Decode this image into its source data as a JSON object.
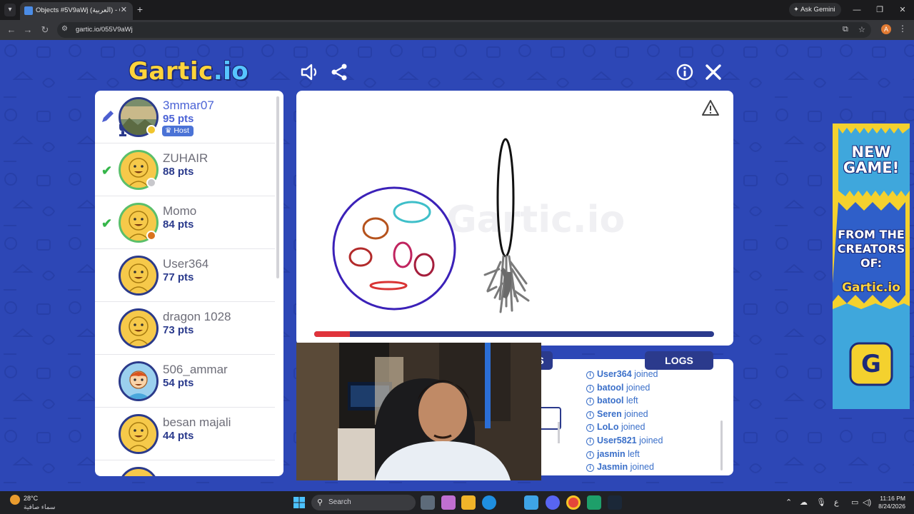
{
  "browser": {
    "tab_title": "Objects #5V9aWj (العربية) - Gar",
    "url": "gartic.io/055V9aWj",
    "gemini_label": "Ask Gemini",
    "profile_initial": "A"
  },
  "game": {
    "logo_main": "Gartic",
    "logo_suffix": ".io",
    "players": [
      {
        "name": "3mmar07",
        "pts": "95 pts",
        "badge": "Host",
        "status": "drawing"
      },
      {
        "name": "ZUHAIR",
        "pts": "88 pts",
        "status": "guessed"
      },
      {
        "name": "Momo",
        "pts": "84 pts",
        "status": "guessed"
      },
      {
        "name": "User364",
        "pts": "77 pts",
        "status": ""
      },
      {
        "name": "dragon 1028",
        "pts": "73 pts",
        "status": ""
      },
      {
        "name": "506_ammar",
        "pts": "54 pts",
        "status": ""
      },
      {
        "name": "besan majali",
        "pts": "44 pts",
        "status": ""
      }
    ],
    "timer_progress": 0.09,
    "tabs": {
      "answers_partial": "S",
      "logs": "LOGS"
    },
    "logs": [
      {
        "user": "User364",
        "action": "joined"
      },
      {
        "user": "batool",
        "action": "joined"
      },
      {
        "user": "batool",
        "action": "left"
      },
      {
        "user": "Seren",
        "action": "joined"
      },
      {
        "user": "LoLo",
        "action": "joined"
      },
      {
        "user": "User5821",
        "action": "joined"
      },
      {
        "user": "jasmin",
        "action": "left"
      },
      {
        "user": "Jasmin",
        "action": "joined"
      }
    ],
    "ad": {
      "line1": "NEW",
      "line2": "GAME!",
      "line3": "FROM THE",
      "line4": "CREATORS",
      "line5": "OF:",
      "brand": "Gartic.io"
    }
  },
  "taskbar": {
    "temperature": "28°C",
    "condition": "سماء صافية",
    "search_label": "Search",
    "time": "11:16 PM",
    "date": "8/24/2026",
    "lang": "ع"
  }
}
